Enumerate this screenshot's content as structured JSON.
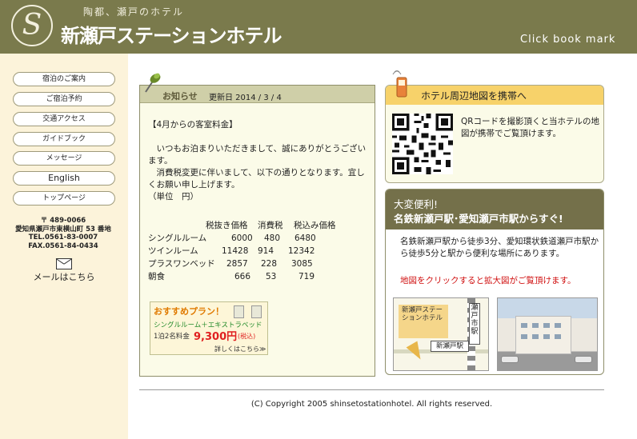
{
  "header": {
    "logo_letter": "S",
    "tagline": "陶都、瀬戸のホテル",
    "hotel_name": "新瀬戸ステーションホテル",
    "bookmark_label": "Click book mark"
  },
  "sidebar": {
    "nav": [
      {
        "label": "宿泊のご案内"
      },
      {
        "label": "ご宿泊予約"
      },
      {
        "label": "交通アクセス"
      },
      {
        "label": "ガイドブック"
      },
      {
        "label": "メッセージ"
      },
      {
        "label": "English"
      },
      {
        "label": "トップページ"
      }
    ],
    "address": {
      "postal": "〒 489-0066",
      "street": "愛知県瀬戸市東横山町 53 番地",
      "tel": "TEL.0561-83-0007",
      "fax": "FAX.0561-84-0434"
    },
    "mail_label": "メールはこちら"
  },
  "notice": {
    "title": "お知らせ",
    "updated": "更新日 2014 / 3 / 4",
    "heading": "【4月からの客室料金】",
    "para1": "　いつもお泊まりいただきまして、誠にありがとうございます。",
    "para2": "　消費税変更に伴いまして、以下の通りとなります。宜しくお願い申し上げます。",
    "unit": "（単位　円）",
    "rate_headers": [
      "税抜き価格",
      "消費税",
      "税込み価格"
    ],
    "rates": [
      {
        "room": "シングルルーム",
        "base": "6000",
        "tax": "480",
        "total": "6480"
      },
      {
        "room": "ツインルーム",
        "base": "11428",
        "tax": "914",
        "total": "12342"
      },
      {
        "room": "プラスワンベッド",
        "base": "2857",
        "tax": "228",
        "total": "3085"
      },
      {
        "room": "朝食",
        "base": "666",
        "tax": "53",
        "total": "719"
      }
    ],
    "promo": {
      "title": "おすすめプラン！",
      "line1": "シングルルーム＋エキストラベッド",
      "line2": "1泊2名料金",
      "price": "9,300円",
      "tax": "(税込)",
      "more": "詳しくはこちら≫"
    }
  },
  "qr_panel": {
    "title": "ホテル周辺地図を携帯へ",
    "text": "QRコードを撮影頂くと当ホテルの地図が携帯でご覧頂けます。"
  },
  "access": {
    "title1": "大変便利!",
    "title2": "名鉄新瀬戸駅･愛知瀬戸市駅からすぐ!",
    "text": "名鉄新瀬戸駅から徒歩3分、愛知環状鉄道瀬戸市駅から徒歩5分と駅から便利な場所にあります。",
    "note": "地図をクリックすると拡大図がご覧頂けます。",
    "map": {
      "hotel_label": "新瀬戸ステーションホテル",
      "station_v": "瀬戸市駅",
      "station_h": "新瀬戸駅"
    }
  },
  "footer": {
    "copyright": "(C) Copyright 2005 shinsetostationhotel. All rights reserved."
  },
  "colors": {
    "header_bg": "#7a7a4c",
    "sidebar_bg": "#fcf3da",
    "qr_head": "#f7d26a",
    "access_head": "#74704a",
    "alert_red": "#d01010"
  }
}
